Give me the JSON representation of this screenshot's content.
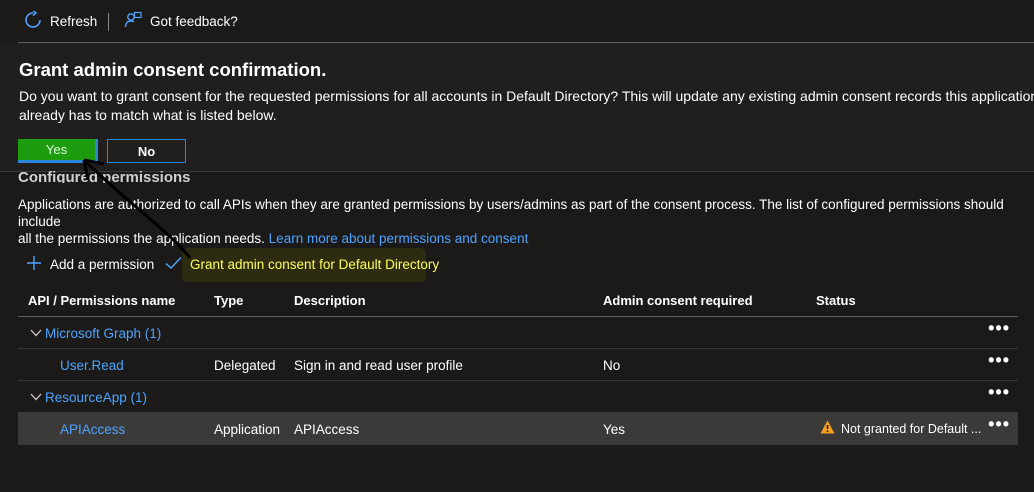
{
  "toolbar": {
    "refresh_label": "Refresh",
    "feedback_label": "Got feedback?"
  },
  "dialog": {
    "title": "Grant admin consent confirmation.",
    "text_line1": "Do you want to grant consent for the requested permissions for all accounts in Default Directory? This will update any existing admin consent records this application",
    "text_line2": "already has to match what is listed below.",
    "yes_label": "Yes",
    "no_label": "No"
  },
  "section": {
    "heading_partial": "Configured permissions",
    "para_line1": "Applications are authorized to call APIs when they are granted permissions by users/admins as part of the consent process. The list of configured permissions should include",
    "para_line2": "all the permissions the application needs.",
    "learn_more_link": "Learn more about permissions and consent"
  },
  "commands": {
    "add_permission": "Add a permission",
    "grant_consent": "Grant admin consent for Default Directory"
  },
  "table": {
    "headers": {
      "api": "API / Permissions name",
      "type": "Type",
      "description": "Description",
      "admin_consent": "Admin consent required",
      "status": "Status"
    },
    "groups": [
      {
        "name": "Microsoft Graph (1)",
        "rows": [
          {
            "name": "User.Read",
            "type": "Delegated",
            "description": "Sign in and read user profile",
            "admin_consent": "No",
            "status": ""
          }
        ]
      },
      {
        "name": "ResourceApp (1)",
        "rows": [
          {
            "name": "APIAccess",
            "type": "Application",
            "description": "APIAccess",
            "admin_consent": "Yes",
            "status": "Not granted for Default ..."
          }
        ]
      }
    ],
    "more_label": "•••"
  },
  "colors": {
    "accent": "#2b88d8",
    "link": "#4ea3ff",
    "yes_button": "#1e9c10",
    "warning": "#f7a11a",
    "grant_highlight": "#ffff5a"
  },
  "icons": {
    "refresh": "refresh-icon",
    "feedback": "feedback-icon",
    "add": "plus-icon",
    "check": "checkmark-icon",
    "chevron": "chevron-down-icon",
    "warning": "warning-icon"
  }
}
